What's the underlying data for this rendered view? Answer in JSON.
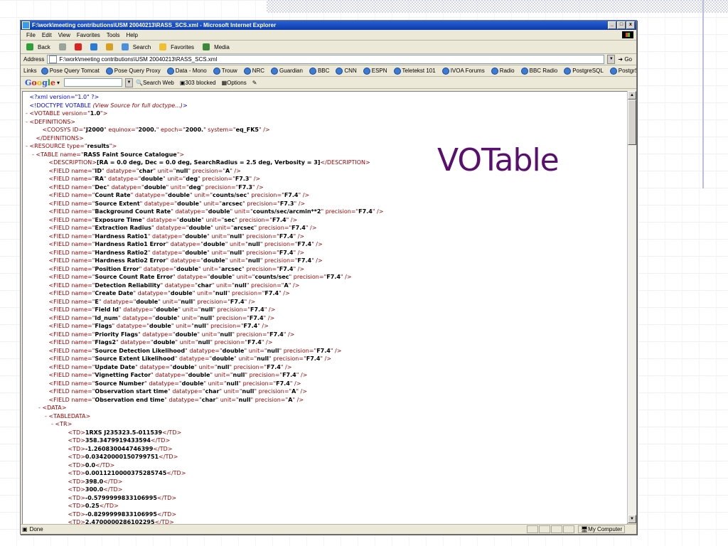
{
  "slide": {
    "title": "VOTable"
  },
  "window": {
    "title": "F:\\work\\meeting contributions\\USM 20040213\\RASS_SCS.xml - Microsoft Internet Explorer",
    "controls": [
      "_",
      "□",
      "x"
    ]
  },
  "menu": [
    "File",
    "Edit",
    "View",
    "Favorites",
    "Tools",
    "Help"
  ],
  "toolbar": [
    {
      "label": "Back",
      "icon": "back-icon"
    },
    {
      "label": "",
      "icon": "forward-icon"
    },
    {
      "label": "",
      "icon": "stop-icon"
    },
    {
      "label": "",
      "icon": "refresh-icon"
    },
    {
      "label": "",
      "icon": "home-icon"
    },
    {
      "label": "Search",
      "icon": "search-icon"
    },
    {
      "label": "Favorites",
      "icon": "favorites-icon"
    },
    {
      "label": "Media",
      "icon": "media-icon"
    }
  ],
  "address": {
    "label": "Address",
    "value": "F:\\work\\meeting contributions\\USM 20040213\\RASS_SCS.xml",
    "go": "Go"
  },
  "links": {
    "label": "Links",
    "items": [
      "Pose Query Tomcat",
      "Pose Query Proxy",
      "Data - Mono",
      "Trouw",
      "NRC",
      "Guardian",
      "BBC",
      "CNN",
      "ESPN",
      "Teletekst 101",
      "IVOA Forums",
      "Radio",
      "BBC Radio",
      "PostgreSQL",
      "PostgrSQL Admin"
    ]
  },
  "google": {
    "logo": "Google",
    "search_web": "Search Web",
    "blocked": "303 blocked",
    "options": "Options"
  },
  "xml": {
    "decl": "<?xml version=\"1.0\" ?>",
    "doctype_open": "<!DOCTYPE VOTABLE ",
    "doctype_link": "(View Source for full doctype...)",
    "doctype_close": ">",
    "votable_version": "1.0",
    "coosys": {
      "ID": "J2000",
      "equinox": "2000.",
      "epoch": "2000.",
      "system": "eq_FK5"
    },
    "resource_type": "results",
    "table_name": "RASS Faint Source Catalogue",
    "description": "[RA = 0.0 deg, Dec = 0.0 deg, SearchRadius = 2.5 deg, Verbosity = 3]",
    "fields": [
      {
        "name": "ID",
        "datatype": "char",
        "unit": "null",
        "precision": "A"
      },
      {
        "name": "RA",
        "datatype": "double",
        "unit": "deg",
        "precision": "F7.3"
      },
      {
        "name": "Dec",
        "datatype": "double",
        "unit": "deg",
        "precision": "F7.3"
      },
      {
        "name": "Count Rate",
        "datatype": "double",
        "unit": "counts/sec",
        "precision": "F7.4"
      },
      {
        "name": "Source Extent",
        "datatype": "double",
        "unit": "arcsec",
        "precision": "F7.3"
      },
      {
        "name": "Background Count Rate",
        "datatype": "double",
        "unit": "counts/sec/arcmin**2",
        "precision": "F7.4"
      },
      {
        "name": "Exposure Time",
        "datatype": "double",
        "unit": "sec",
        "precision": "F7.4"
      },
      {
        "name": "Extraction Radius",
        "datatype": "double",
        "unit": "arcsec",
        "precision": "F7.4"
      },
      {
        "name": "Hardness Ratio1",
        "datatype": "double",
        "unit": "null",
        "precision": "F7.4"
      },
      {
        "name": "Hardness Ratio1 Error",
        "datatype": "double",
        "unit": "null",
        "precision": "F7.4"
      },
      {
        "name": "Hardness Ratio2",
        "datatype": "double",
        "unit": "null",
        "precision": "F7.4"
      },
      {
        "name": "Hardness Ratio2 Error",
        "datatype": "double",
        "unit": "null",
        "precision": "F7.4"
      },
      {
        "name": "Position Error",
        "datatype": "double",
        "unit": "arcsec",
        "precision": "F7.4"
      },
      {
        "name": "Source Count Rate Error",
        "datatype": "double",
        "unit": "counts/sec",
        "precision": "F7.4"
      },
      {
        "name": "Detection Reliability",
        "datatype": "char",
        "unit": "null",
        "precision": "A"
      },
      {
        "name": "Create Date",
        "datatype": "double",
        "unit": "null",
        "precision": "F7.4"
      },
      {
        "name": "E",
        "datatype": "double",
        "unit": "null",
        "precision": "F7.4"
      },
      {
        "name": "Field Id",
        "datatype": "double",
        "unit": "null",
        "precision": "F7.4"
      },
      {
        "name": "Id_num",
        "datatype": "double",
        "unit": "null",
        "precision": "F7.4"
      },
      {
        "name": "Flags",
        "datatype": "double",
        "unit": "null",
        "precision": "F7.4"
      },
      {
        "name": "Priority Flags",
        "datatype": "double",
        "unit": "null",
        "precision": "F7.4"
      },
      {
        "name": "Flags2",
        "datatype": "double",
        "unit": "null",
        "precision": "F7.4"
      },
      {
        "name": "Source Detection Likelihood",
        "datatype": "double",
        "unit": "null",
        "precision": "F7.4"
      },
      {
        "name": "Source Extent Likelihood",
        "datatype": "double",
        "unit": "null",
        "precision": "F7.4"
      },
      {
        "name": "Update Date",
        "datatype": "double",
        "unit": "null",
        "precision": "F7.4"
      },
      {
        "name": "Vignetting Factor",
        "datatype": "double",
        "unit": "null",
        "precision": "F7.4"
      },
      {
        "name": "Source Number",
        "datatype": "double",
        "unit": "null",
        "precision": "F7.4"
      },
      {
        "name": "Observation start time",
        "datatype": "char",
        "unit": "null",
        "precision": "A"
      },
      {
        "name": "Observation end time",
        "datatype": "char",
        "unit": "null",
        "precision": "A"
      }
    ],
    "tds": [
      "1RXS J235323.5-011539",
      "358.3479919433594",
      "-1.260830044746399",
      "0.03420000150799751",
      "0.0",
      "0.001121000037528574​5",
      "398.0",
      "300.0",
      "-0.5799999833106995",
      "0.25",
      "-0.8299999833106995",
      "2.470000028610229​5"
    ]
  },
  "status": {
    "text": "Done",
    "zone": "My Computer"
  }
}
